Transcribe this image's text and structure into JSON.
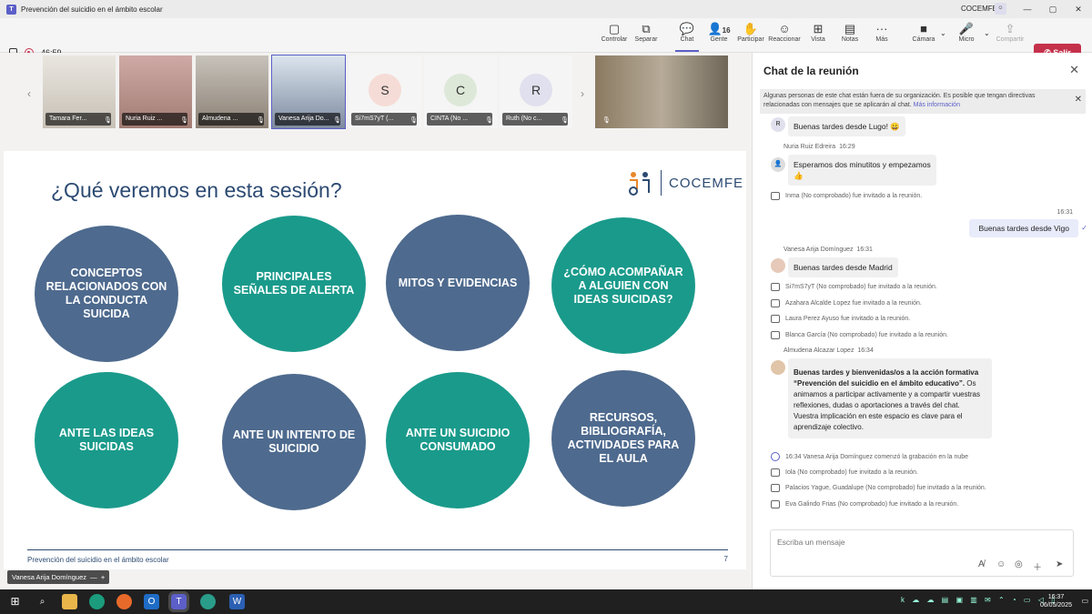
{
  "window": {
    "title": "Prevención del suicidio en el ámbito escolar",
    "org": "COCEMFE",
    "org_badge": "☺"
  },
  "toolbar": {
    "timer": "46:59",
    "items": [
      {
        "label": "Controlar",
        "icon": "▢"
      },
      {
        "label": "Separar",
        "icon": "⧉"
      },
      {
        "label": "Chat",
        "icon": "💬"
      },
      {
        "label": "Gente",
        "icon": "👤",
        "count": "16"
      },
      {
        "label": "Participar",
        "icon": "✋"
      },
      {
        "label": "Reaccionar",
        "icon": "☺"
      },
      {
        "label": "Vista",
        "icon": "⊞"
      },
      {
        "label": "Notas",
        "icon": "▤"
      },
      {
        "label": "Más",
        "icon": "···"
      },
      {
        "label": "Cámara",
        "icon": "■"
      },
      {
        "label": "Micro",
        "icon": "🎤"
      },
      {
        "label": "Compartir",
        "icon": "⇪"
      }
    ],
    "leave": "Salir"
  },
  "participants": [
    {
      "name": "Tamara Fer..."
    },
    {
      "name": "Nuria Ruiz ..."
    },
    {
      "name": "Almudena ..."
    },
    {
      "name": "Vanesa Arija Do..."
    },
    {
      "name": "Si7mS7yT (...",
      "initial": "S",
      "color": "#f5e6e6"
    },
    {
      "name": "CINTA (No ...",
      "initial": "C",
      "color": "#e3ece3"
    },
    {
      "name": "Ruth (No c...",
      "initial": "R",
      "color": "#e6e6f0"
    }
  ],
  "slide": {
    "title": "¿Qué veremos en esta sesión?",
    "logo": "COCEMFE",
    "circles": [
      "CONCEPTOS RELACIONADOS CON LA CONDUCTA SUICIDA",
      "PRINCIPALES SEÑALES DE ALERTA",
      "MITOS Y EVIDENCIAS",
      "¿CÓMO ACOMPAÑAR A ALGUIEN CON IDEAS SUICIDAS?",
      "ANTE LAS IDEAS SUICIDAS",
      "ANTE UN INTENTO DE SUICIDIO",
      "ANTE UN SUICIDIO CONSUMADO",
      "RECURSOS, BIBLIOGRAFÍA, ACTIVIDADES PARA EL AULA"
    ],
    "footer": "Prevención del suicidio en el ámbito escolar",
    "page": "7"
  },
  "presenter": "Vanesa Arija Domínguez",
  "chat": {
    "title": "Chat de la reunión",
    "banner": "Algunas personas de este chat están fuera de su organización. Es posible que tengan directivas relacionadas con mensajes que se aplicarán al chat.",
    "banner_link": "Más información",
    "m1": {
      "initial": "R",
      "text": "Buenas tardes desde Lugo! 😀"
    },
    "m2": {
      "sender": "Nuria Ruiz Edreira",
      "time": "16:29",
      "text": "Esperamos dos minutitos y empezamos",
      "emoji": "👍"
    },
    "s1": "Inma (No comprobado) fue invitado a la reunión.",
    "m3": {
      "time": "16:31",
      "text": "Buenas tardes desde Vigo"
    },
    "m4": {
      "sender": "Vanesa Arija Domínguez",
      "time": "16:31",
      "text": "Buenas tardes desde Madrid"
    },
    "s2": "Si7mS7yT (No comprobado) fue invitado a la reunión.",
    "s3": "Azahara Alcalde Lopez fue invitado a la reunión.",
    "s4": "Laura Perez Ayuso fue invitado a la reunión.",
    "s5": "Blanca García (No comprobado) fue invitado a la reunión.",
    "m5": {
      "sender": "Almudena Alcazar Lopez",
      "time": "16:34",
      "bold": "Buenas tardes y bienvenidas/os a la acción formativa “Prevención del suicidio en el ámbito educativo”.",
      "text": " Os animamos a participar activamente y a compartir vuestras reflexiones, dudas o aportaciones a través del chat. Vuestra implicación en este espacio es clave para el aprendizaje colectivo."
    },
    "s6": "16:34   Vanesa Arija Domínguez comenzó la grabación en la nube",
    "s7": "Iola (No comprobado) fue invitado a la reunión.",
    "s8": "Palacios Yague, Guadalupe (No comprobado) fue invitado a la reunión.",
    "s9": "Eva Galindo Frias (No comprobado) fue invitado a la reunión.",
    "compose_placeholder": "Escriba un mensaje"
  },
  "taskbar": {
    "time": "16:37",
    "date": "06/05/2025"
  }
}
